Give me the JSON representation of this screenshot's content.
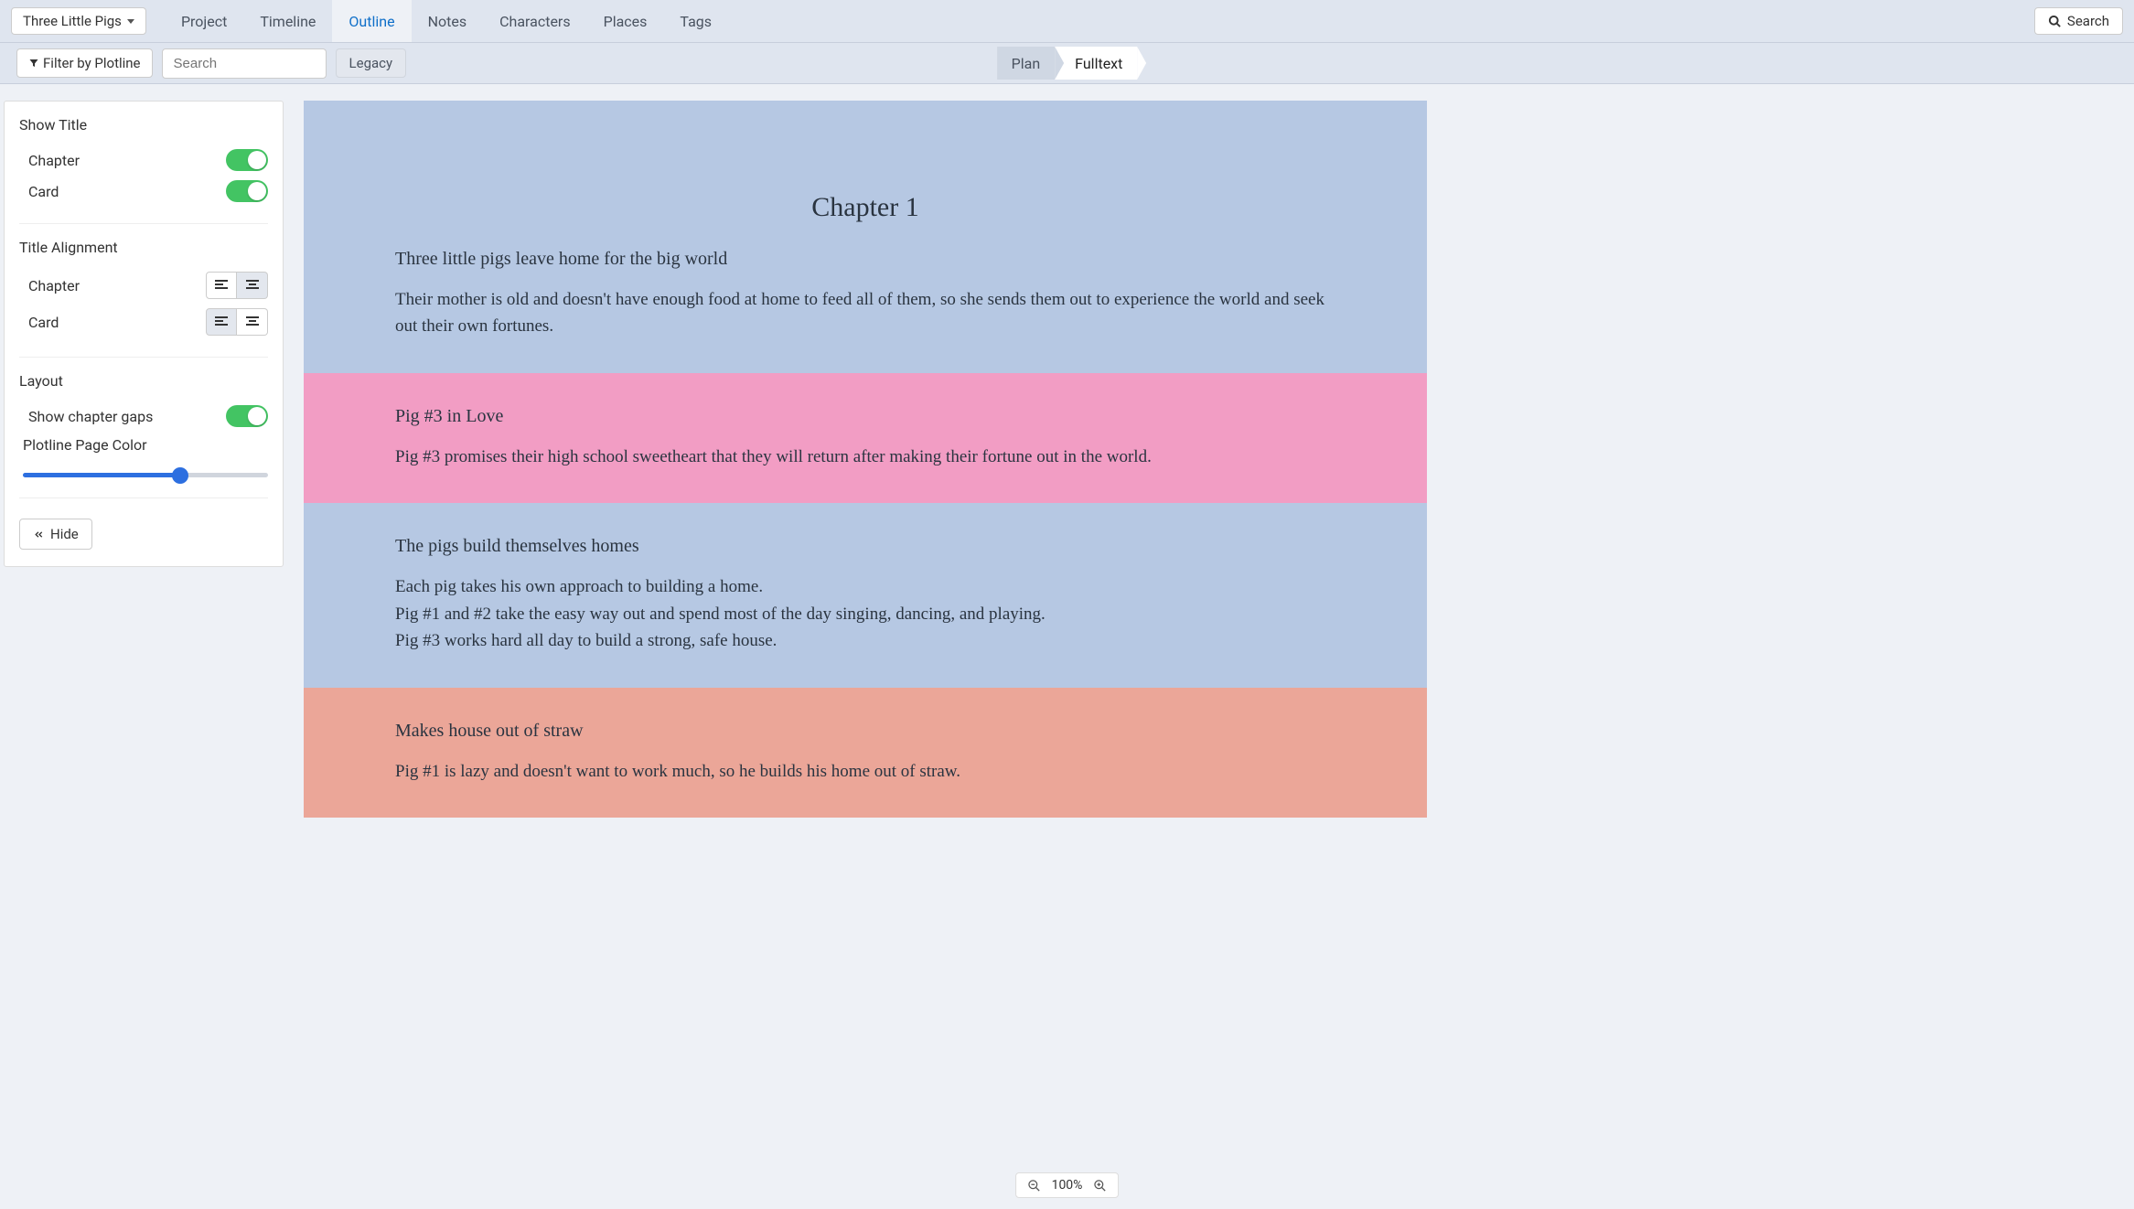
{
  "project_name": "Three Little Pigs",
  "nav": [
    "Project",
    "Timeline",
    "Outline",
    "Notes",
    "Characters",
    "Places",
    "Tags"
  ],
  "nav_active": "Outline",
  "search_label": "Search",
  "toolbar": {
    "filter_label": "Filter by Plotline",
    "search_placeholder": "Search",
    "legacy_label": "Legacy"
  },
  "breadcrumb": {
    "plan": "Plan",
    "fulltext": "Fulltext"
  },
  "sidebar": {
    "show_title_heading": "Show Title",
    "chapter_label": "Chapter",
    "card_label": "Card",
    "title_align_heading": "Title Alignment",
    "layout_heading": "Layout",
    "show_gaps_label": "Show chapter gaps",
    "plotline_color_label": "Plotline Page Color",
    "hide_label": "Hide",
    "toggles": {
      "chapter": true,
      "card": true,
      "show_gaps": true
    },
    "chapter_align": "center",
    "card_align": "left",
    "color_slider": 65
  },
  "chapter_title": "Chapter 1",
  "cards": [
    {
      "color": "blue",
      "title": "Three little pigs leave home for the big world",
      "body": [
        "Their mother is old and doesn't have enough food at home to feed all of them, so she sends them out to experience the world and seek out their own fortunes."
      ]
    },
    {
      "color": "pink",
      "title": "Pig #3 in Love",
      "body": [
        "Pig #3 promises their high school sweetheart that they will return after making their fortune out in the world."
      ]
    },
    {
      "color": "blue",
      "title": "The pigs build themselves homes",
      "body": [
        "Each pig takes his own approach to building a home.",
        "Pig #1 and #2 take the easy way out and spend most of the day singing, dancing, and playing.",
        "Pig #3 works hard all day to build a strong, safe house."
      ]
    },
    {
      "color": "red",
      "title": "Makes house out of straw",
      "body": [
        "Pig #1 is lazy and doesn't want to work much, so he builds his home out of straw."
      ]
    }
  ],
  "zoom": "100%"
}
